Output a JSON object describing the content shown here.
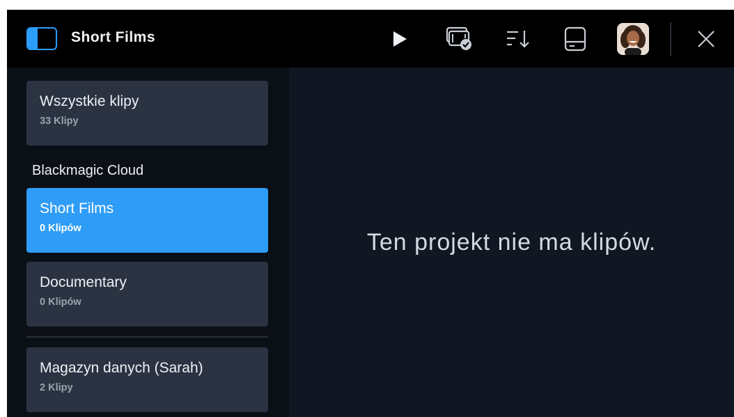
{
  "header": {
    "title": "Short Films",
    "icons": [
      "sidebar-toggle-icon",
      "play-icon",
      "media-ready-icon",
      "sort-icon",
      "storage-icon",
      "avatar",
      "close-icon"
    ]
  },
  "sidebar": {
    "all_clips": {
      "name": "Wszystkie klipy",
      "count": "33 Klipy"
    },
    "section_label": "Blackmagic Cloud",
    "projects": [
      {
        "name": "Short Films",
        "count": "0 Klipów",
        "selected": true
      },
      {
        "name": "Documentary",
        "count": "0 Klipów",
        "selected": false
      }
    ],
    "storage": {
      "name": "Magazyn danych (Sarah)",
      "count": "2 Klipy"
    }
  },
  "main": {
    "empty_message": "Ten projekt nie ma klipów."
  },
  "colors": {
    "accent": "#2f9df7",
    "card_bg": "#2b3342",
    "background": "#111722",
    "topbar": "#000000"
  }
}
